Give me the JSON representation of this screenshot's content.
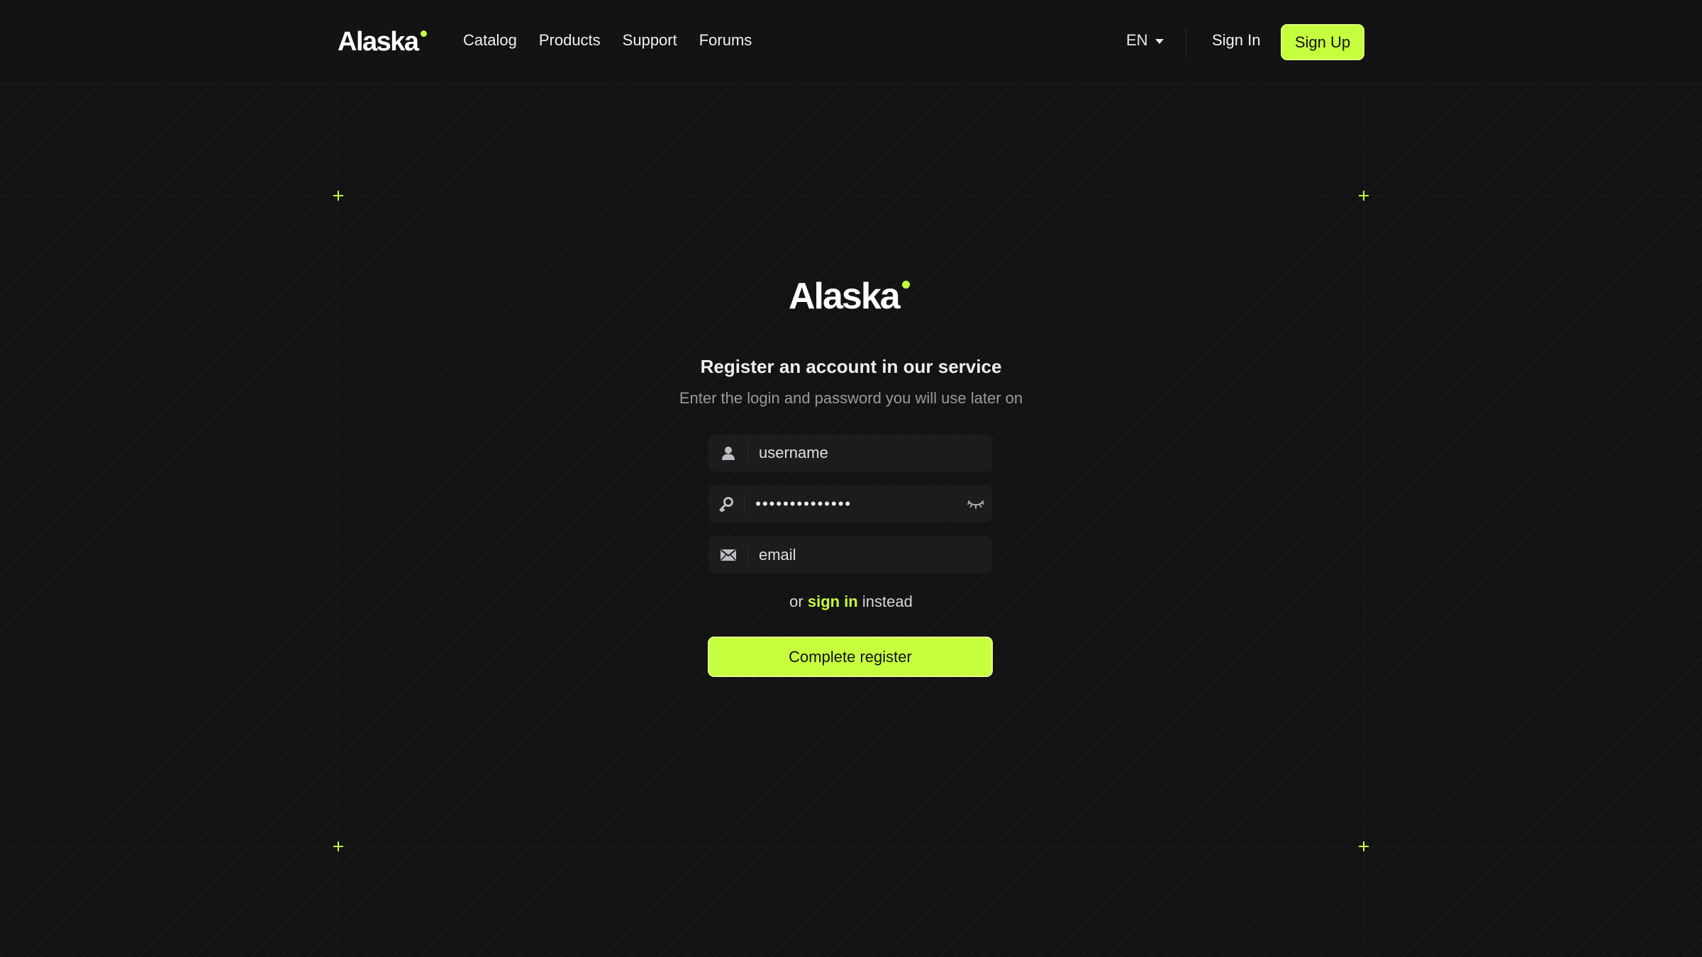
{
  "header": {
    "brand": "Alaska",
    "nav": [
      {
        "label": "Catalog"
      },
      {
        "label": "Products"
      },
      {
        "label": "Support"
      },
      {
        "label": "Forums"
      }
    ],
    "language": "EN",
    "sign_in_label": "Sign In",
    "sign_up_label": "Sign Up"
  },
  "form": {
    "brand": "Alaska",
    "title": "Register an account in our service",
    "subtitle": "Enter the login and password you will use later on",
    "username_placeholder": "username",
    "password_value": "••••••••••••••",
    "email_placeholder": "email",
    "or_prefix": "or",
    "sign_in_link": "sign in",
    "or_suffix": "instead",
    "submit_label": "Complete register"
  },
  "icons": {
    "user": "user-icon",
    "password": "key-icon",
    "email": "mail-icon",
    "toggle": "eye-closed-icon",
    "corner": "plus-icon"
  },
  "colors": {
    "accent": "#c6ff3d",
    "background": "#131314",
    "field": "#1c1c1e"
  }
}
